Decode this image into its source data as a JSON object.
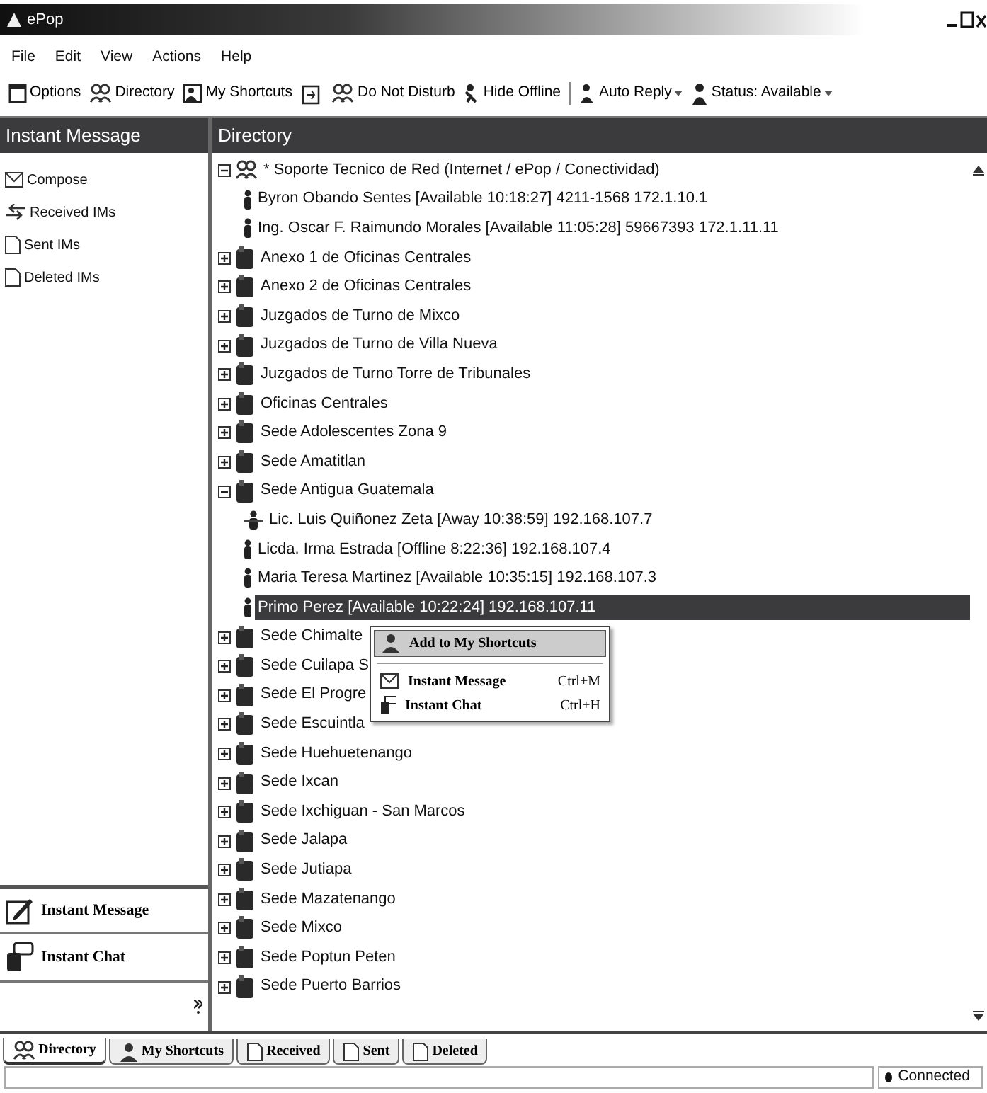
{
  "window": {
    "title": "ePop"
  },
  "menu": [
    "File",
    "Edit",
    "View",
    "Actions",
    "Help"
  ],
  "toolbar": [
    {
      "kind": "options",
      "label": "Options",
      "dropdown": false
    },
    {
      "kind": "directory",
      "label": "Directory",
      "dropdown": false
    },
    {
      "kind": "shortcuts",
      "label": "My Shortcuts",
      "dropdown": false
    },
    {
      "kind": "export"
    },
    {
      "kind": "dnd",
      "label": "Do Not Disturb",
      "dropdown": false
    },
    {
      "kind": "hide",
      "label": "Hide Offline",
      "dropdown": false
    },
    {
      "kind": "reply",
      "label": "Auto Reply",
      "dropdown": true
    },
    {
      "kind": "status",
      "label": "Status:  Available",
      "dropdown": true
    }
  ],
  "sidebar": {
    "title": "Instant Message",
    "items": [
      {
        "kind": "compose",
        "label": "Compose"
      },
      {
        "kind": "received",
        "label": "Received IMs"
      },
      {
        "kind": "sent",
        "label": "Sent IMs"
      },
      {
        "kind": "deleted",
        "label": "Deleted IMs"
      }
    ],
    "buttons": [
      {
        "kind": "message",
        "label": "Instant Message"
      },
      {
        "kind": "chat",
        "label": "Instant Chat"
      }
    ]
  },
  "directory": {
    "title": "Directory",
    "tree": [
      {
        "kind": "team",
        "label": "* Soporte Tecnico de Red (Internet / ePop / Conectividad)",
        "expanded": true,
        "selected": false,
        "children": [
          {
            "kind": "contact",
            "label": "Byron Obando Sentes [Available 10:18:27] 4211-1568 172.1.10.1",
            "away": false,
            "selected": false
          },
          {
            "kind": "contact",
            "label": "Ing. Oscar F. Raimundo Morales [Available 11:05:28] 59667393 172.1.11.11",
            "away": false,
            "selected": false
          }
        ]
      },
      {
        "kind": "group",
        "label": "Anexo 1 de Oficinas Centrales",
        "expanded": false,
        "selected": false
      },
      {
        "kind": "group",
        "label": "Anexo 2 de Oficinas Centrales",
        "expanded": false,
        "selected": false
      },
      {
        "kind": "group",
        "label": "Juzgados de Turno de Mixco",
        "expanded": false,
        "selected": false
      },
      {
        "kind": "group",
        "label": "Juzgados de Turno de Villa Nueva",
        "expanded": false,
        "selected": false
      },
      {
        "kind": "group",
        "label": "Juzgados de Turno Torre de Tribunales",
        "expanded": false,
        "selected": false
      },
      {
        "kind": "group",
        "label": "Oficinas Centrales",
        "expanded": false,
        "selected": false
      },
      {
        "kind": "group",
        "label": "Sede Adolescentes Zona 9",
        "expanded": false,
        "selected": false
      },
      {
        "kind": "group",
        "label": "Sede Amatitlan",
        "expanded": false,
        "selected": false
      },
      {
        "kind": "group",
        "label": "Sede Antigua Guatemala",
        "expanded": true,
        "selected": false,
        "children": [
          {
            "kind": "contact",
            "label": "Lic. Luis Quiñonez Zeta [Away 10:38:59] 192.168.107.7",
            "away": true,
            "selected": false
          },
          {
            "kind": "contact",
            "label": "Licda. Irma Estrada [Offline 8:22:36] 192.168.107.4",
            "away": false,
            "selected": false
          },
          {
            "kind": "contact",
            "label": "Maria Teresa Martinez [Available 10:35:15] 192.168.107.3",
            "away": false,
            "selected": false
          },
          {
            "kind": "contact",
            "label": "Primo Perez [Available 10:22:24] 192.168.107.11",
            "away": false,
            "selected": true
          }
        ]
      },
      {
        "kind": "group",
        "label": "Sede Chimalte",
        "expanded": false,
        "selected": false
      },
      {
        "kind": "group",
        "label": "Sede Cuilapa S",
        "expanded": false,
        "selected": false
      },
      {
        "kind": "group",
        "label": "Sede El Progre",
        "expanded": false,
        "selected": false
      },
      {
        "kind": "group",
        "label": "Sede Escuintla",
        "expanded": false,
        "selected": false
      },
      {
        "kind": "group",
        "label": "Sede Huehuetenango",
        "expanded": false,
        "selected": false
      },
      {
        "kind": "group",
        "label": "Sede Ixcan",
        "expanded": false,
        "selected": false
      },
      {
        "kind": "group",
        "label": "Sede Ixchiguan - San Marcos",
        "expanded": false,
        "selected": false
      },
      {
        "kind": "group",
        "label": "Sede Jalapa",
        "expanded": false,
        "selected": false
      },
      {
        "kind": "group",
        "label": "Sede Jutiapa",
        "expanded": false,
        "selected": false
      },
      {
        "kind": "group",
        "label": "Sede Mazatenango",
        "expanded": false,
        "selected": false
      },
      {
        "kind": "group",
        "label": "Sede Mixco",
        "expanded": false,
        "selected": false
      },
      {
        "kind": "group",
        "label": "Sede Poptun Peten",
        "expanded": false,
        "selected": false
      },
      {
        "kind": "group",
        "label": "Sede Puerto Barrios",
        "expanded": false,
        "selected": false
      }
    ]
  },
  "context_menu": [
    {
      "kind": "shortcut",
      "label": "Add to My Shortcuts",
      "selected": true,
      "divider_after": true
    },
    {
      "kind": "message",
      "label": "Instant Message",
      "shortcut": "Ctrl+M",
      "selected": false,
      "divider_after": false
    },
    {
      "kind": "chat",
      "label": "Instant Chat",
      "shortcut": "Ctrl+H",
      "selected": false,
      "divider_after": false
    }
  ],
  "tabs": [
    {
      "kind": "directory",
      "label": "Directory",
      "selected": true
    },
    {
      "kind": "shortcuts",
      "label": "My Shortcuts",
      "selected": false
    },
    {
      "kind": "received",
      "label": "Received",
      "selected": false
    },
    {
      "kind": "sent",
      "label": "Sent",
      "selected": false
    },
    {
      "kind": "deleted",
      "label": "Deleted",
      "selected": false
    }
  ],
  "status_bar": {
    "connection": "Connected"
  }
}
